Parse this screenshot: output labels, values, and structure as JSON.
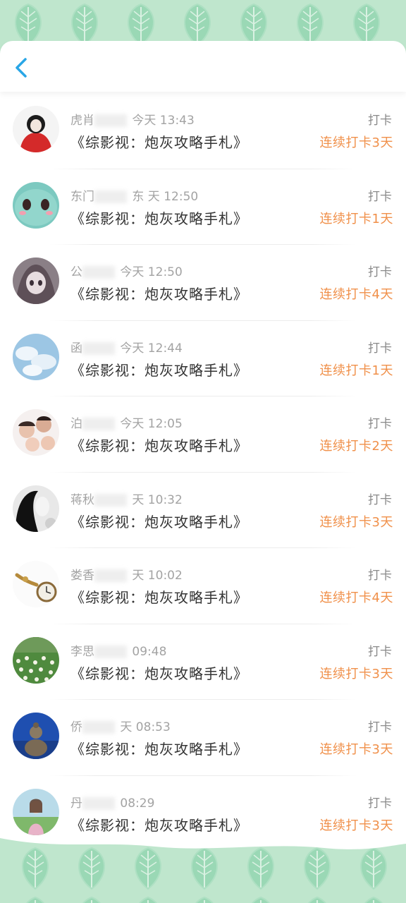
{
  "colors": {
    "accent_blue": "#29a6e6",
    "streak_orange": "#f0904a",
    "leaf_bg": "#bfe6cd",
    "leaf_fg": "#8fd1ab"
  },
  "header": {
    "back_icon": "chevron-left-icon"
  },
  "checkins": [
    {
      "name": "虎肖",
      "time": "今天 13:43",
      "title": "《综影视：炮灰攻略手札》",
      "action": "打卡",
      "streak": "连续打卡3天"
    },
    {
      "name": "东门",
      "time": "东 天 12:50",
      "title": "《综影视：炮灰攻略手札》",
      "action": "打卡",
      "streak": "连续打卡1天"
    },
    {
      "name": "公",
      "time": "今天 12:50",
      "title": "《综影视：炮灰攻略手札》",
      "action": "打卡",
      "streak": "连续打卡4天"
    },
    {
      "name": "函",
      "time": "今天 12:44",
      "title": "《综影视：炮灰攻略手札》",
      "action": "打卡",
      "streak": "连续打卡1天"
    },
    {
      "name": "泊",
      "time": "今天 12:05",
      "title": "《综影视：炮灰攻略手札》",
      "action": "打卡",
      "streak": "连续打卡2天"
    },
    {
      "name": "蒋秋",
      "time": "天 10:32",
      "title": "《综影视：炮灰攻略手札》",
      "action": "打卡",
      "streak": "连续打卡3天"
    },
    {
      "name": "娄香",
      "time": "天 10:02",
      "title": "《综影视：炮灰攻略手札》",
      "action": "打卡",
      "streak": "连续打卡4天"
    },
    {
      "name": "李思",
      "time": "09:48",
      "title": "《综影视：炮灰攻略手札》",
      "action": "打卡",
      "streak": "连续打卡3天"
    },
    {
      "name": "侨",
      "time": "天 08:53",
      "title": "《综影视：炮灰攻略手札》",
      "action": "打卡",
      "streak": "连续打卡3天"
    },
    {
      "name": "丹",
      "time": "08:29",
      "title": "《综影视：炮灰攻略手札》",
      "action": "打卡",
      "streak": "连续打卡3天"
    }
  ]
}
